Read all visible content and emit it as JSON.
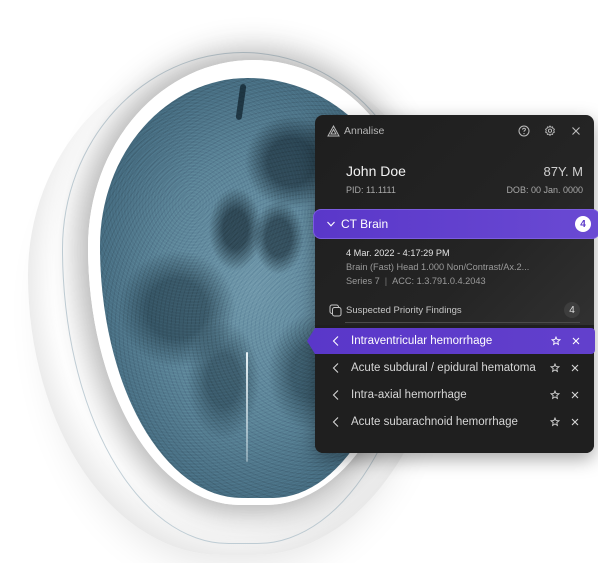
{
  "app": {
    "brand_name": "Annalise"
  },
  "topbar": {
    "icons": [
      "help-icon",
      "settings-icon",
      "close-icon"
    ]
  },
  "patient": {
    "name": "John Doe",
    "age_sex": "87Y. M",
    "pid": "PID: 11.1111",
    "dob": "DOB: 00 Jan. 0000"
  },
  "study": {
    "title": "CT Brain",
    "count": "4",
    "date": "4 Mar. 2022 - 4:17:29 PM",
    "description": "Brain (Fast) Head 1.000 Non/Contrast/Ax.2...",
    "series": "Series 7",
    "acc": "ACC: 1.3.791.0.4.2043",
    "accent_color": "#5a37c9"
  },
  "findings": {
    "title": "Suspected Priority Findings",
    "count": "4",
    "items": [
      {
        "label": "Intraventricular hemorrhage",
        "active": true
      },
      {
        "label": "Acute subdural / epidural hematoma",
        "active": false
      },
      {
        "label": "Intra-axial hemorrhage",
        "active": false
      },
      {
        "label": "Acute subarachnoid hemorrhage",
        "active": false
      }
    ]
  }
}
